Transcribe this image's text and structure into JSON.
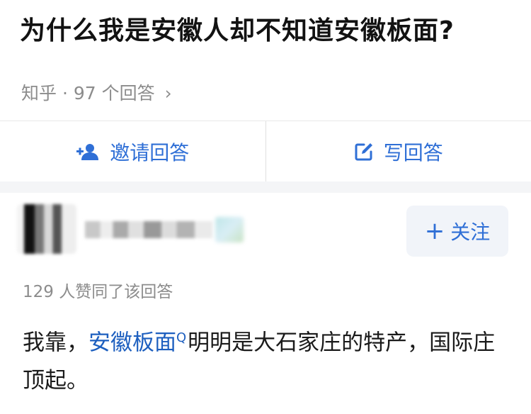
{
  "question": {
    "title": "为什么我是安徽人却不知道安徽板面?"
  },
  "meta": {
    "source": "知乎",
    "separator": "·",
    "answer_count": "97 个回答",
    "chevron": "›"
  },
  "actions": {
    "invite_label": "邀请回答",
    "write_label": "写回答"
  },
  "answer": {
    "follow_label": "关注",
    "follow_plus": "+",
    "votes_text": "129 人赞同了该回答",
    "text_before": "我靠，",
    "link_text": "安徽板面",
    "search_mark": "Q",
    "text_after": "明明是大石家庄的特产，国际庄顶起。"
  },
  "colors": {
    "accent": "#2f6fd6",
    "link": "#1d5fbf",
    "muted": "#8c8c8c"
  }
}
